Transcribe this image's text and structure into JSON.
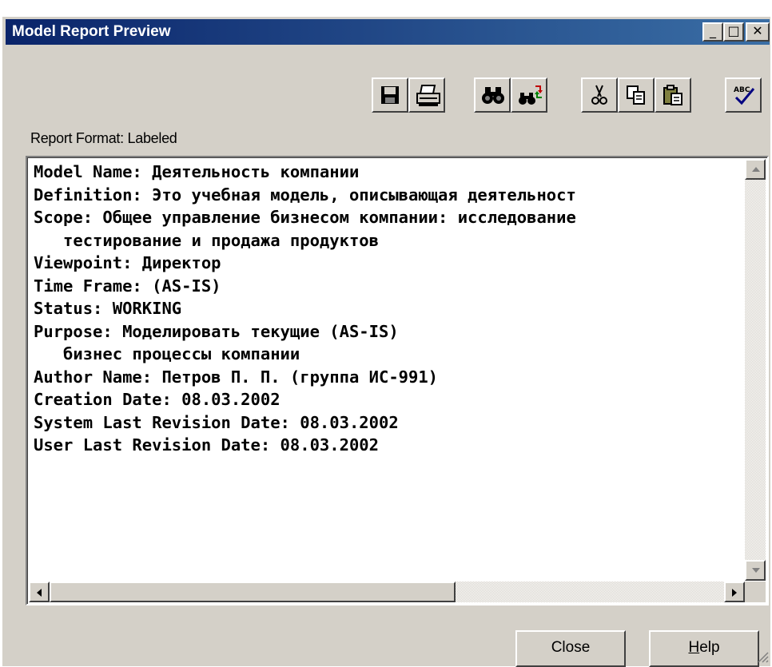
{
  "window": {
    "title": "Model Report Preview",
    "minimize_glyph": "_",
    "maximize_glyph": "□",
    "close_glyph": "✕"
  },
  "toolbar": {
    "buttons": [
      {
        "icon": "save-icon"
      },
      {
        "icon": "print-icon"
      },
      {
        "icon": "find-icon"
      },
      {
        "icon": "replace-icon"
      },
      {
        "icon": "cut-icon"
      },
      {
        "icon": "copy-icon"
      },
      {
        "icon": "paste-icon"
      },
      {
        "icon": "spell-check-icon"
      }
    ]
  },
  "report_format": "Report Format: Labeled",
  "report_lines": [
    "Model Name: Деятельность компании",
    "Definition: Это учебная модель, описывающая деятельност",
    "Scope: Общее управление бизнесом компании: исследование",
    "   тестирование и продажа продуктов",
    "Viewpoint: Директор",
    "Time Frame: (AS-IS)",
    "Status: WORKING",
    "Purpose: Моделировать текущие (AS-IS)",
    "   бизнес процессы компании",
    "Author Name: Петров П. П. (группа ИС-991)",
    "Creation Date: 08.03.2002",
    "System Last Revision Date: 08.03.2002",
    "User Last Revision Date: 08.03.2002"
  ],
  "buttons": {
    "close": "Close",
    "help_mnemonic": "H",
    "help_rest": "elp"
  },
  "colors": {
    "titlebar_start": "#0a246a",
    "titlebar_end": "#3a6ea5",
    "face": "#d4d0c8"
  }
}
